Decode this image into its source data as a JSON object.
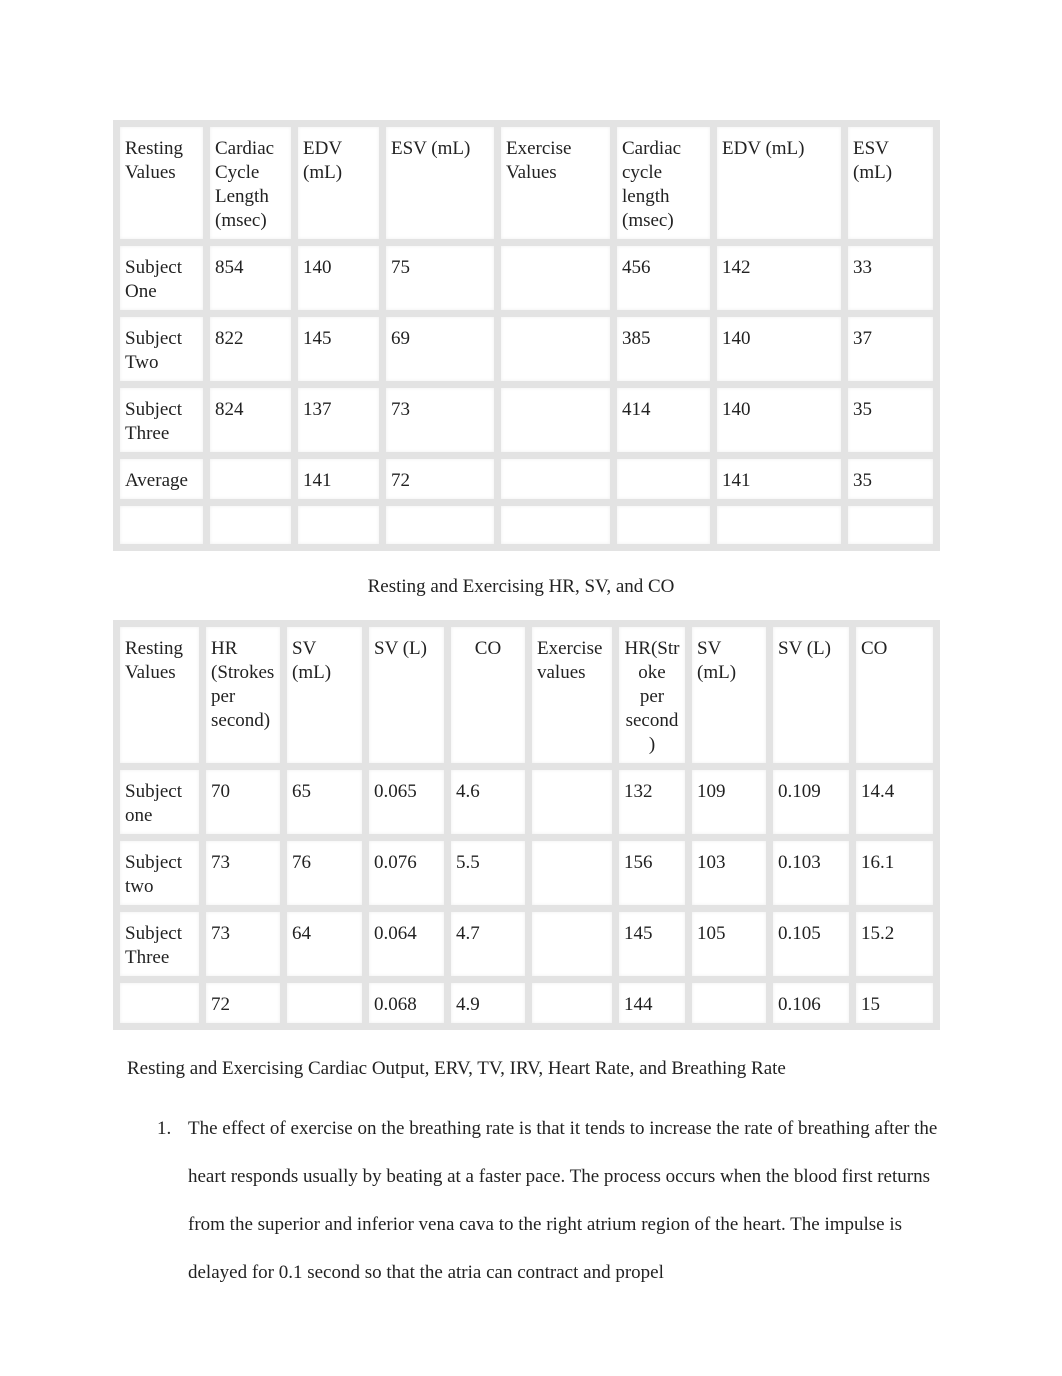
{
  "table1": {
    "header": [
      "Resting Values",
      "Cardiac Cycle Length (msec)",
      "EDV (mL)",
      "ESV (mL)",
      "Exercise Values",
      "Cardiac cycle length (msec)",
      "EDV (mL)",
      "ESV (mL)"
    ],
    "rows": [
      [
        "Subject One",
        "854",
        "140",
        "75",
        "",
        "456",
        "142",
        "33"
      ],
      [
        "Subject Two",
        "822",
        "145",
        "69",
        "",
        "385",
        "140",
        "37"
      ],
      [
        "Subject Three",
        "824",
        "137",
        "73",
        "",
        "414",
        "140",
        "35"
      ],
      [
        "Average",
        "",
        "141",
        "72",
        "",
        "",
        "141",
        "35"
      ],
      [
        "",
        "",
        "",
        "",
        "",
        "",
        "",
        ""
      ]
    ]
  },
  "caption2": "Resting and Exercising HR, SV, and CO",
  "table2": {
    "header": [
      "Resting Values",
      "HR (Strokes per second)",
      "SV (mL)",
      "SV (L)",
      "CO",
      "Exercise values",
      "HR(Stroke per second)",
      "SV (mL)",
      "SV (L)",
      "CO"
    ],
    "rows": [
      [
        "Subject one",
        "70",
        "65",
        "0.065",
        "4.6",
        "",
        "132",
        "109",
        "0.109",
        "14.4"
      ],
      [
        "Subject two",
        "73",
        "76",
        "0.076",
        "5.5",
        "",
        "156",
        "103",
        "0.103",
        "16.1"
      ],
      [
        "Subject Three",
        "73",
        "64",
        "0.064",
        "4.7",
        "",
        "145",
        "105",
        "0.105",
        "15.2"
      ],
      [
        "",
        "72",
        "",
        "0.068",
        "4.9",
        "",
        "144",
        "",
        "0.106",
        "15"
      ]
    ]
  },
  "heading3": "Resting and Exercising Cardiac Output, ERV, TV, IRV, Heart Rate, and Breathing Rate",
  "list": [
    {
      "number": "1.",
      "text": "The effect of exercise on the breathing rate is that it tends to increase the rate of breathing after the heart responds usually by beating at a faster pace. The process occurs when the blood first returns from the superior and inferior vena cava to the right atrium region of the heart. The impulse is delayed for 0.1 second so that the atria can contract and propel"
    }
  ]
}
